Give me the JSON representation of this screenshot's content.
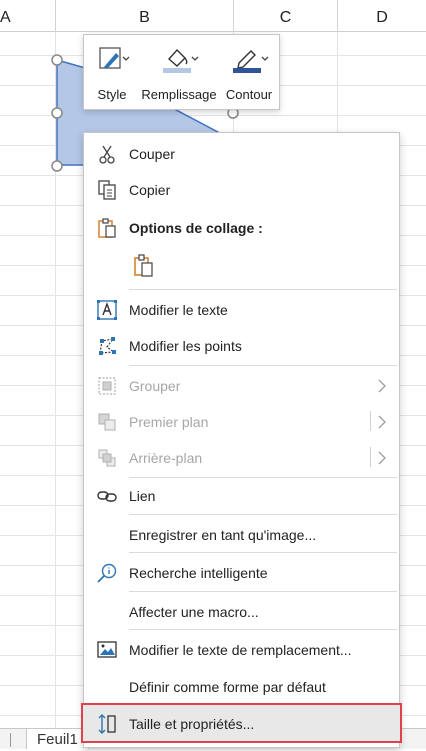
{
  "columns": [
    "A",
    "B",
    "C",
    "D"
  ],
  "sheet_tab": "Feuil1",
  "mini_toolbar": [
    {
      "label": "Style",
      "icon": "shape-style-icon"
    },
    {
      "label": "Remplissage",
      "icon": "fill-bucket-icon"
    },
    {
      "label": "Contour",
      "icon": "outline-pen-icon"
    }
  ],
  "context_menu": {
    "couper": "Couper",
    "copier": "Copier",
    "options_collage": "Options de collage :",
    "modifier_texte": "Modifier le texte",
    "modifier_points": "Modifier les points",
    "grouper": "Grouper",
    "premier_plan": "Premier plan",
    "arriere_plan": "Arrière-plan",
    "lien": "Lien",
    "enregistrer_image": "Enregistrer en tant qu'image...",
    "recherche": "Recherche intelligente",
    "affecter_macro": "Affecter une macro...",
    "texte_remplacement": "Modifier le texte de remplacement...",
    "forme_defaut": "Définir comme forme par défaut",
    "taille_proprietes": "Taille et propriétés..."
  },
  "colors": {
    "shape_fill": "#b4c7e7",
    "shape_border": "#4472c4",
    "highlight_border": "#e0424b",
    "icon_blue": "#2e75b6",
    "paste_orange": "#d9822b"
  }
}
